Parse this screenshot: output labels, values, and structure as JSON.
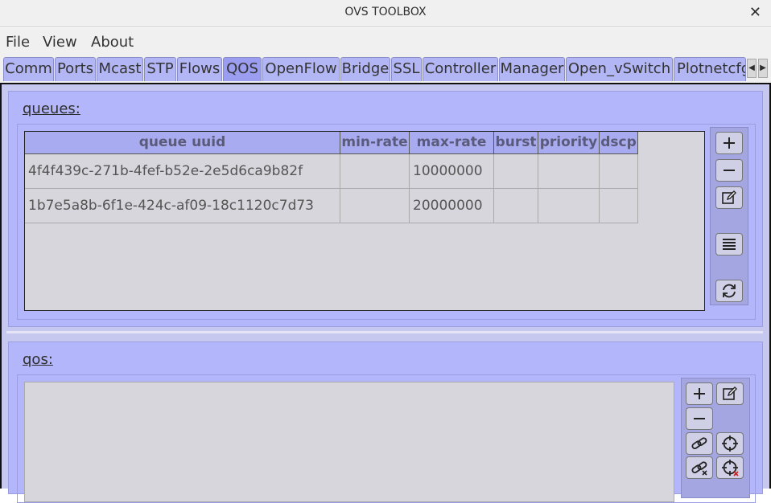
{
  "window": {
    "title": "OVS TOOLBOX",
    "close_glyph": "✕"
  },
  "menu": {
    "file": "File",
    "view": "View",
    "about": "About"
  },
  "tabs": [
    "Comm",
    "Ports",
    "Mcast",
    "STP",
    "Flows",
    "QOS",
    "OpenFlow",
    "Bridge",
    "SSL",
    "Controller",
    "Manager",
    "Open_vSwitch",
    "Plotnetcfg"
  ],
  "active_tab": "QOS",
  "tab_scroll": {
    "left": "◀",
    "right": "▶"
  },
  "queues": {
    "label": "queues:",
    "columns": [
      "queue uuid",
      "min-rate",
      "max-rate",
      "burst",
      "priority",
      "dscp"
    ],
    "rows": [
      [
        "4f4f439c-271b-4fef-b52e-2e5d6ca9b82f",
        "",
        "10000000",
        "",
        "",
        ""
      ],
      [
        "1b7e5a8b-6f1e-424c-af09-18c1120c7d73",
        "",
        "20000000",
        "",
        "",
        ""
      ]
    ],
    "tools": [
      "add-icon",
      "remove-icon",
      "edit-icon",
      "list-icon",
      "refresh-icon"
    ]
  },
  "qos": {
    "label": "qos:",
    "tools": [
      "add-icon",
      "edit-icon",
      "remove-icon",
      "link-icon",
      "target-icon",
      "unlink-icon",
      "target-remove-icon"
    ]
  },
  "colors": {
    "panel": "#b3b6fa",
    "tab": "#b3b6f5",
    "header": "#a9abf0",
    "table_bg": "#d6d6dc"
  }
}
